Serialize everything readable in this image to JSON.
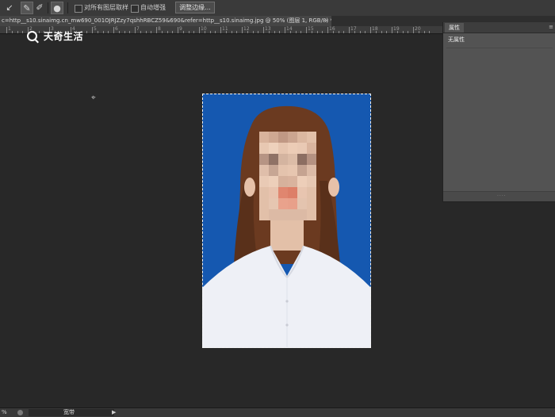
{
  "options_bar": {
    "tools": [
      {
        "icon": "quick-select-brush-icon",
        "glyph": "↙"
      },
      {
        "icon": "add-to-selection-icon",
        "glyph": "✎"
      },
      {
        "icon": "subtract-from-selection-icon",
        "glyph": "✐"
      }
    ],
    "brush_size_glyph": "●",
    "sample_all_layers_label": "对所有图层取样",
    "auto_enhance_label": "自动增强",
    "refine_edge_label": "调整边缘..."
  },
  "document_tab": {
    "title": "c=http__s10.sinaimg.cn_mw690_001OJRJZzy7qshhRBCZ59&690&refer=http__s10.sinaimg.jpg @ 50% (图层 1, RGB/8) *",
    "close_glyph": "×"
  },
  "ruler": {
    "numbers": [
      "1",
      "2",
      "3",
      "4",
      "5",
      "6",
      "7",
      "8",
      "9",
      "10",
      "11",
      "12",
      "13",
      "14",
      "15",
      "16",
      "17",
      "18",
      "19",
      "20"
    ]
  },
  "watermark": {
    "text": "天奇生活"
  },
  "cursor_glyph": "⌖",
  "properties_panel": {
    "tab_label": "属性",
    "menu_glyph": "≡",
    "no_properties_label": "无属性",
    "grip_glyph": "····"
  },
  "status_bar": {
    "zoom": "%",
    "arrow_glyph": "▶",
    "info_label": "宽带"
  }
}
